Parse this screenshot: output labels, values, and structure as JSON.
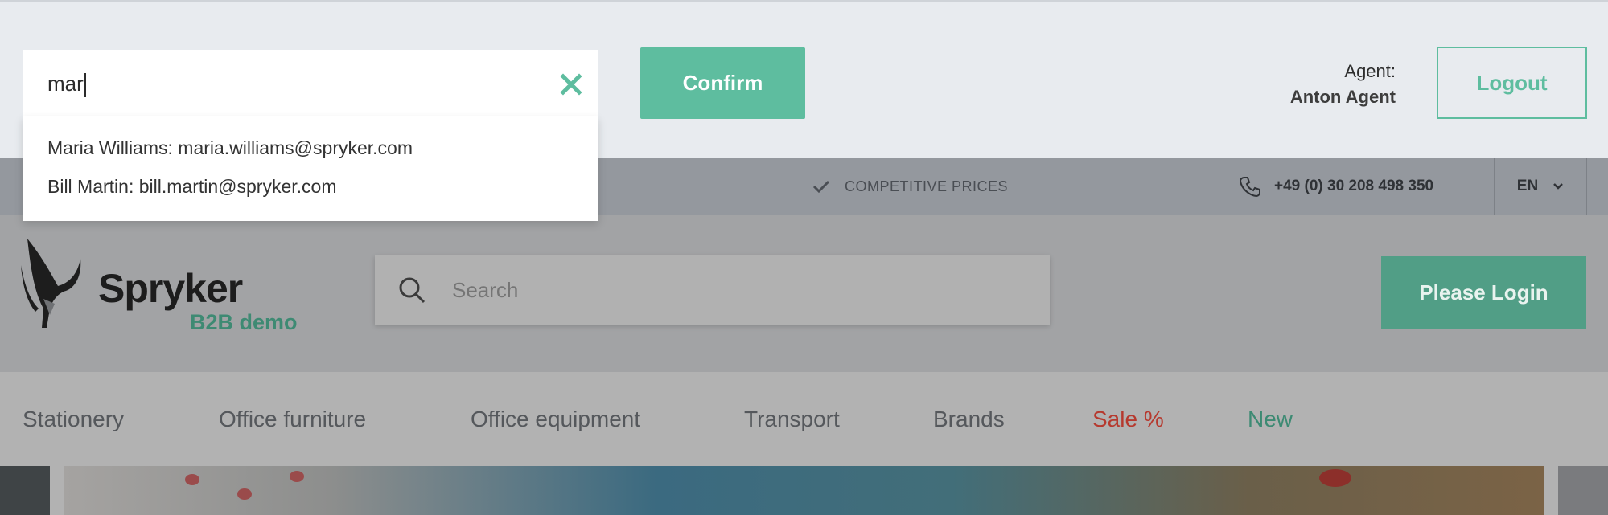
{
  "agent_bar": {
    "search_value": "mar",
    "confirm_label": "Confirm",
    "agent_label": "Agent:",
    "agent_name": "Anton Agent",
    "logout_label": "Logout"
  },
  "dropdown": {
    "items": [
      "Maria Williams: maria.williams@spryker.com",
      "Bill Martin: bill.martin@spryker.com"
    ]
  },
  "info_bar": {
    "benefit": "COMPETITIVE PRICES",
    "phone": "+49 (0) 30 208 498 350",
    "language": "EN"
  },
  "header": {
    "logo_name": "Spryker",
    "logo_sub": "B2B demo",
    "search_placeholder": "Search",
    "login_label": "Please Login"
  },
  "nav": {
    "items": [
      "Stationery",
      "Office furniture",
      "Office equipment",
      "Transport",
      "Brands",
      "Sale %",
      "New"
    ]
  },
  "colors": {
    "accent": "#5ebd9f",
    "sale": "#b6392e"
  }
}
